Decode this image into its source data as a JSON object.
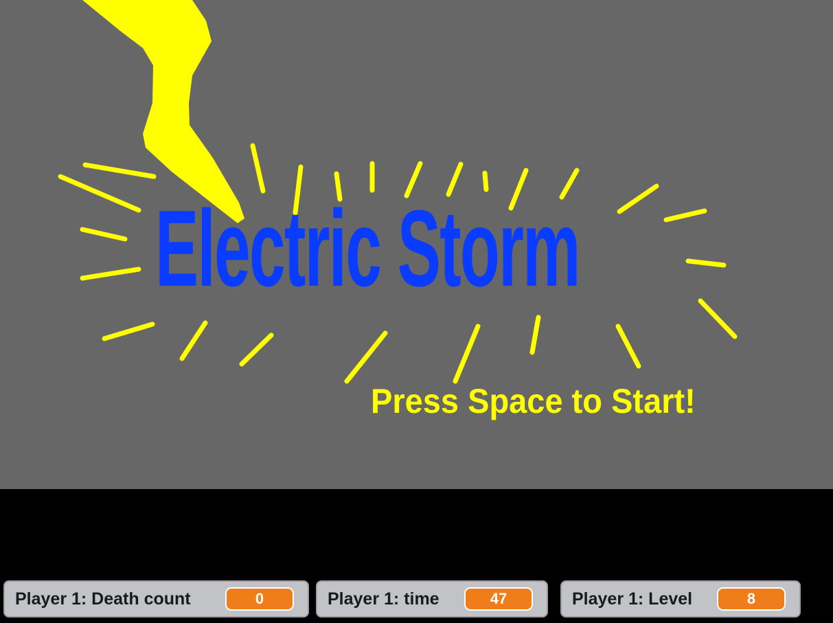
{
  "game": {
    "title": "Electric Storm",
    "subtitle": "Press Space to Start!",
    "colors": {
      "background": "#676767",
      "title": "#0a3cff",
      "lightning": "#ffff00",
      "subtitle": "#ffff00",
      "monitor_value": "#ef7d1a"
    }
  },
  "monitors": [
    {
      "label": "Player 1: Death count",
      "value": "0"
    },
    {
      "label": "Player 1: time",
      "value": "47"
    },
    {
      "label": "Player 1: Level",
      "value": "8"
    }
  ]
}
